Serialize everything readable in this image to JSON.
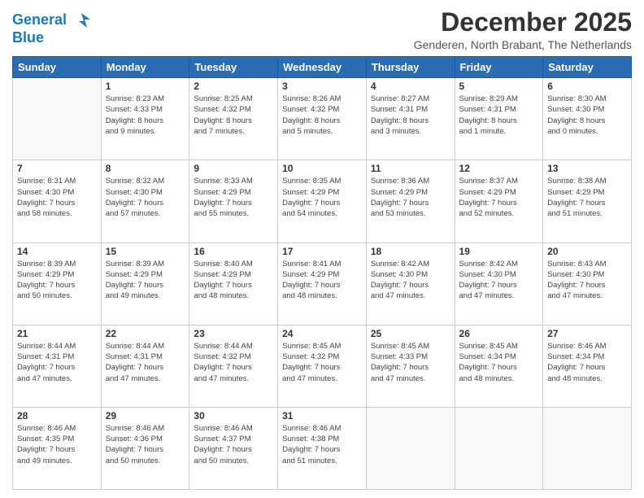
{
  "logo": {
    "line1": "General",
    "line2": "Blue"
  },
  "header": {
    "month": "December 2025",
    "location": "Genderen, North Brabant, The Netherlands"
  },
  "weekdays": [
    "Sunday",
    "Monday",
    "Tuesday",
    "Wednesday",
    "Thursday",
    "Friday",
    "Saturday"
  ],
  "weeks": [
    [
      {
        "day": "",
        "info": ""
      },
      {
        "day": "1",
        "info": "Sunrise: 8:23 AM\nSunset: 4:33 PM\nDaylight: 8 hours\nand 9 minutes."
      },
      {
        "day": "2",
        "info": "Sunrise: 8:25 AM\nSunset: 4:32 PM\nDaylight: 8 hours\nand 7 minutes."
      },
      {
        "day": "3",
        "info": "Sunrise: 8:26 AM\nSunset: 4:32 PM\nDaylight: 8 hours\nand 5 minutes."
      },
      {
        "day": "4",
        "info": "Sunrise: 8:27 AM\nSunset: 4:31 PM\nDaylight: 8 hours\nand 3 minutes."
      },
      {
        "day": "5",
        "info": "Sunrise: 8:29 AM\nSunset: 4:31 PM\nDaylight: 8 hours\nand 1 minute."
      },
      {
        "day": "6",
        "info": "Sunrise: 8:30 AM\nSunset: 4:30 PM\nDaylight: 8 hours\nand 0 minutes."
      }
    ],
    [
      {
        "day": "7",
        "info": "Sunrise: 8:31 AM\nSunset: 4:30 PM\nDaylight: 7 hours\nand 58 minutes."
      },
      {
        "day": "8",
        "info": "Sunrise: 8:32 AM\nSunset: 4:30 PM\nDaylight: 7 hours\nand 57 minutes."
      },
      {
        "day": "9",
        "info": "Sunrise: 8:33 AM\nSunset: 4:29 PM\nDaylight: 7 hours\nand 55 minutes."
      },
      {
        "day": "10",
        "info": "Sunrise: 8:35 AM\nSunset: 4:29 PM\nDaylight: 7 hours\nand 54 minutes."
      },
      {
        "day": "11",
        "info": "Sunrise: 8:36 AM\nSunset: 4:29 PM\nDaylight: 7 hours\nand 53 minutes."
      },
      {
        "day": "12",
        "info": "Sunrise: 8:37 AM\nSunset: 4:29 PM\nDaylight: 7 hours\nand 52 minutes."
      },
      {
        "day": "13",
        "info": "Sunrise: 8:38 AM\nSunset: 4:29 PM\nDaylight: 7 hours\nand 51 minutes."
      }
    ],
    [
      {
        "day": "14",
        "info": "Sunrise: 8:39 AM\nSunset: 4:29 PM\nDaylight: 7 hours\nand 50 minutes."
      },
      {
        "day": "15",
        "info": "Sunrise: 8:39 AM\nSunset: 4:29 PM\nDaylight: 7 hours\nand 49 minutes."
      },
      {
        "day": "16",
        "info": "Sunrise: 8:40 AM\nSunset: 4:29 PM\nDaylight: 7 hours\nand 48 minutes."
      },
      {
        "day": "17",
        "info": "Sunrise: 8:41 AM\nSunset: 4:29 PM\nDaylight: 7 hours\nand 48 minutes."
      },
      {
        "day": "18",
        "info": "Sunrise: 8:42 AM\nSunset: 4:30 PM\nDaylight: 7 hours\nand 47 minutes."
      },
      {
        "day": "19",
        "info": "Sunrise: 8:42 AM\nSunset: 4:30 PM\nDaylight: 7 hours\nand 47 minutes."
      },
      {
        "day": "20",
        "info": "Sunrise: 8:43 AM\nSunset: 4:30 PM\nDaylight: 7 hours\nand 47 minutes."
      }
    ],
    [
      {
        "day": "21",
        "info": "Sunrise: 8:44 AM\nSunset: 4:31 PM\nDaylight: 7 hours\nand 47 minutes."
      },
      {
        "day": "22",
        "info": "Sunrise: 8:44 AM\nSunset: 4:31 PM\nDaylight: 7 hours\nand 47 minutes."
      },
      {
        "day": "23",
        "info": "Sunrise: 8:44 AM\nSunset: 4:32 PM\nDaylight: 7 hours\nand 47 minutes."
      },
      {
        "day": "24",
        "info": "Sunrise: 8:45 AM\nSunset: 4:32 PM\nDaylight: 7 hours\nand 47 minutes."
      },
      {
        "day": "25",
        "info": "Sunrise: 8:45 AM\nSunset: 4:33 PM\nDaylight: 7 hours\nand 47 minutes."
      },
      {
        "day": "26",
        "info": "Sunrise: 8:45 AM\nSunset: 4:34 PM\nDaylight: 7 hours\nand 48 minutes."
      },
      {
        "day": "27",
        "info": "Sunrise: 8:46 AM\nSunset: 4:34 PM\nDaylight: 7 hours\nand 48 minutes."
      }
    ],
    [
      {
        "day": "28",
        "info": "Sunrise: 8:46 AM\nSunset: 4:35 PM\nDaylight: 7 hours\nand 49 minutes."
      },
      {
        "day": "29",
        "info": "Sunrise: 8:46 AM\nSunset: 4:36 PM\nDaylight: 7 hours\nand 50 minutes."
      },
      {
        "day": "30",
        "info": "Sunrise: 8:46 AM\nSunset: 4:37 PM\nDaylight: 7 hours\nand 50 minutes."
      },
      {
        "day": "31",
        "info": "Sunrise: 8:46 AM\nSunset: 4:38 PM\nDaylight: 7 hours\nand 51 minutes."
      },
      {
        "day": "",
        "info": ""
      },
      {
        "day": "",
        "info": ""
      },
      {
        "day": "",
        "info": ""
      }
    ]
  ]
}
